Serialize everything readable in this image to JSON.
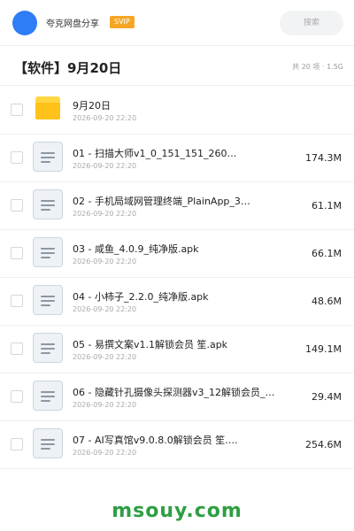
{
  "header": {
    "user_name": "夸克网盘分享",
    "badge": "SVIP",
    "search_label": "搜索"
  },
  "title_bar": {
    "title": "【软件】9月20日",
    "summary": "共 20 项 · 1.5G"
  },
  "files": [
    {
      "type": "folder",
      "name": "9月20日",
      "date": "2026-09-20 22:20",
      "size": ""
    },
    {
      "type": "file",
      "name": "01 - 扫描大师v1_0_151_151_260…",
      "date": "2026-09-20 22:20",
      "size": "174.3M"
    },
    {
      "type": "file",
      "name": "02 - 手机局域网管理终端_PlainApp_3…",
      "date": "2026-09-20 22:20",
      "size": "61.1M"
    },
    {
      "type": "file",
      "name": "03 - 咸鱼_4.0.9_纯净版.apk",
      "date": "2026-09-20 22:20",
      "size": "66.1M"
    },
    {
      "type": "file",
      "name": "04 - 小柿子_2.2.0_纯净版.apk",
      "date": "2026-09-20 22:20",
      "size": "48.6M"
    },
    {
      "type": "file",
      "name": "05 - 易撰文案v1.1解锁会员 笙.apk",
      "date": "2026-09-20 22:20",
      "size": "149.1M"
    },
    {
      "type": "file",
      "name": "06 - 隐藏针孔摄像头探测器v3_12解锁会员_…",
      "date": "2026-09-20 22:20",
      "size": "29.4M"
    },
    {
      "type": "file",
      "name": "07 - AI写真馆v9.0.8.0解锁会员 笙.…",
      "date": "2026-09-20 22:20",
      "size": "254.6M"
    }
  ],
  "watermark": "msouy.com",
  "colors": {
    "accent": "#2f7df6",
    "badge": "#f5a623",
    "folder": "#ffc21a",
    "watermark": "#2e9e43"
  },
  "icons": {
    "folder": "folder-icon",
    "file": "document-icon"
  }
}
